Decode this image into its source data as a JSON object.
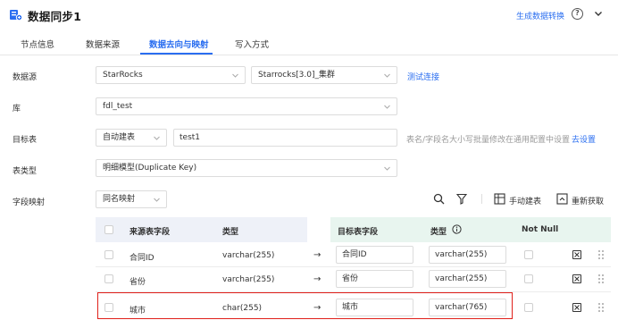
{
  "header": {
    "title": "数据同步1",
    "generate_link": "生成数据转换",
    "help_glyph": "?"
  },
  "tabs": [
    {
      "label": "节点信息"
    },
    {
      "label": "数据来源"
    },
    {
      "label": "数据去向与映射"
    },
    {
      "label": "写入方式"
    }
  ],
  "form": {
    "datasource": {
      "label": "数据源",
      "type_value": "StarRocks",
      "conn_value": "Starrocks[3.0]_集群",
      "test_link": "测试连接"
    },
    "database": {
      "label": "库",
      "value": "fdl_test"
    },
    "target_table": {
      "label": "目标表",
      "mode_value": "自动建表",
      "table_value": "test1",
      "hint": "表名/字段名大小写批量修改在通用配置中设置",
      "hint_link": "去设置"
    },
    "table_type": {
      "label": "表类型",
      "value": "明细模型(Duplicate Key)"
    },
    "field_mapping": {
      "label": "字段映射",
      "mode_value": "同名映射"
    }
  },
  "toolbar": {
    "manual_create": "手动建表",
    "refresh": "重新获取"
  },
  "mapping_table": {
    "headers": {
      "source_field": "来源表字段",
      "source_type": "类型",
      "target_field": "目标表字段",
      "target_type": "类型",
      "not_null": "Not Null"
    },
    "rows": [
      {
        "source_field": "合同ID",
        "source_type": "varchar(255)",
        "target_field": "合同ID",
        "target_type": "varchar(255)"
      },
      {
        "source_field": "省份",
        "source_type": "varchar(255)",
        "target_field": "省份",
        "target_type": "varchar(255)"
      },
      {
        "source_field": "城市",
        "source_type": "char(255)",
        "target_field": "城市",
        "target_type": "varchar(765)"
      }
    ]
  },
  "arrow_glyph": "→",
  "colors": {
    "accent": "#2a6ef0",
    "source_header_bg": "#eef1f8",
    "target_header_bg": "#e8f5ef",
    "highlight": "#e0201a"
  }
}
